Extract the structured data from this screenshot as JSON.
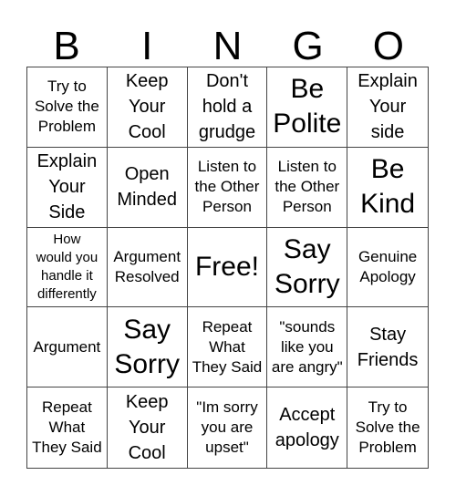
{
  "header": {
    "letters": [
      "B",
      "I",
      "N",
      "G",
      "O"
    ]
  },
  "cells": [
    {
      "text": "Try to\nSolve the\nProblem",
      "size": "md"
    },
    {
      "text": "Keep\nYour\nCool",
      "size": "lg"
    },
    {
      "text": "Don't\nhold a\ngrudge",
      "size": "lg"
    },
    {
      "text": "Be\nPolite",
      "size": "xl"
    },
    {
      "text": "Explain\nYour\nside",
      "size": "lg"
    },
    {
      "text": "Explain\nYour\nSide",
      "size": "lg"
    },
    {
      "text": "Open\nMinded",
      "size": "lg"
    },
    {
      "text": "Listen to\nthe Other\nPerson",
      "size": "md"
    },
    {
      "text": "Listen to\nthe Other\nPerson",
      "size": "md"
    },
    {
      "text": "Be\nKind",
      "size": "xl"
    },
    {
      "text": "How\nwould you\nhandle it\ndifferently",
      "size": "sm"
    },
    {
      "text": "Argument\nResolved",
      "size": "md"
    },
    {
      "text": "Free!",
      "size": "xl"
    },
    {
      "text": "Say\nSorry",
      "size": "xl"
    },
    {
      "text": "Genuine\nApology",
      "size": "md"
    },
    {
      "text": "Argument",
      "size": "md"
    },
    {
      "text": "Say\nSorry",
      "size": "xl"
    },
    {
      "text": "Repeat\nWhat\nThey Said",
      "size": "md"
    },
    {
      "text": "\"sounds\nlike you\nare angry\"",
      "size": "md"
    },
    {
      "text": "Stay\nFriends",
      "size": "lg"
    },
    {
      "text": "Repeat\nWhat\nThey Said",
      "size": "md"
    },
    {
      "text": "Keep\nYour\nCool",
      "size": "lg"
    },
    {
      "text": "\"Im sorry\nyou are\nupset\"",
      "size": "md"
    },
    {
      "text": "Accept\napology",
      "size": "lg"
    },
    {
      "text": "Try to\nSolve the\nProblem",
      "size": "md"
    }
  ]
}
